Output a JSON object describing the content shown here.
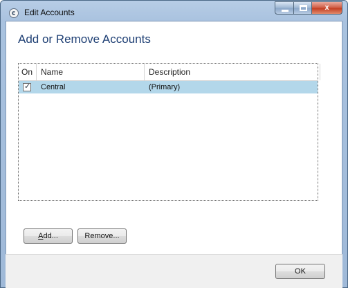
{
  "window": {
    "title": "Edit Accounts",
    "controls": {
      "minimize": "",
      "maximize": "",
      "close": "x"
    }
  },
  "heading": "Add or Remove Accounts",
  "list": {
    "columns": [
      "On",
      "Name",
      "Description"
    ],
    "rows": [
      {
        "on": true,
        "name": "Central",
        "description": "(Primary)"
      }
    ]
  },
  "buttons": {
    "add": {
      "accel": "A",
      "rest": "dd..."
    },
    "remove": "Remove...",
    "ok": "OK"
  },
  "colors": {
    "heading": "#1e3f74",
    "selection": "#b3d7ea",
    "frame": "#a9c2df"
  }
}
